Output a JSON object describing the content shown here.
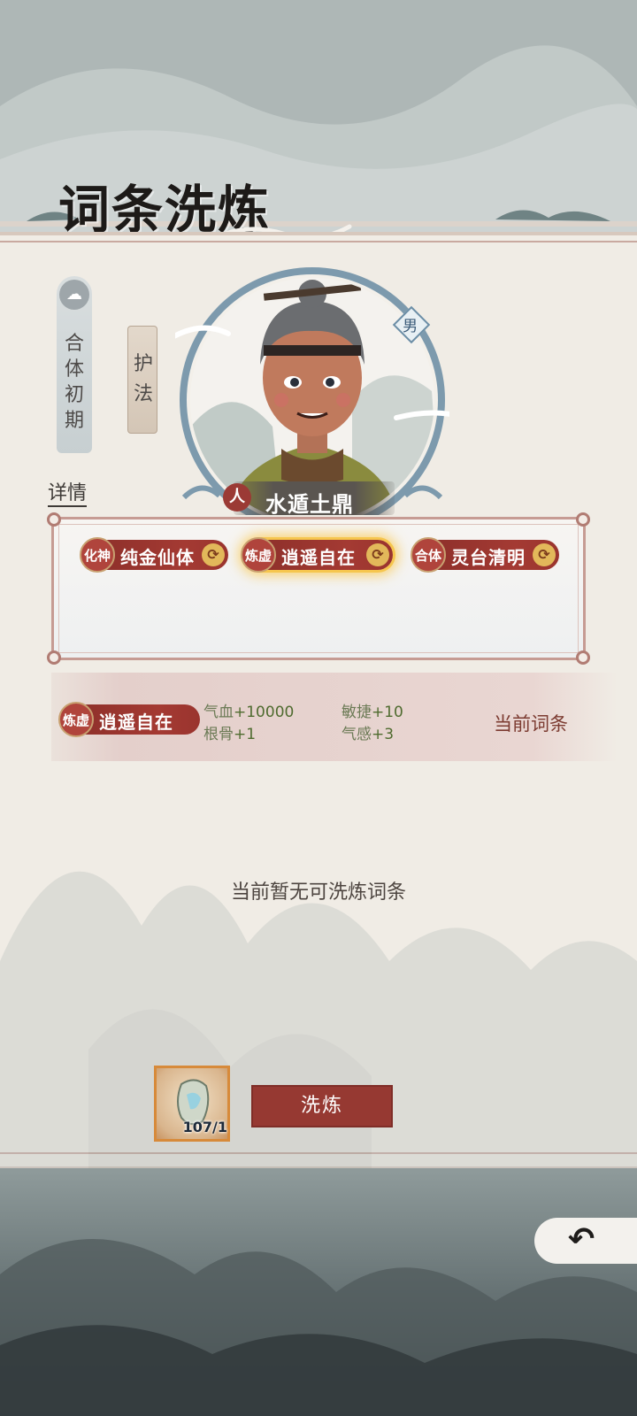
{
  "page": {
    "title": "词条洗炼"
  },
  "character": {
    "realm": "合体初期",
    "guard_tag": "护法",
    "gender": "男",
    "race": "人",
    "name": "水遁土鼎",
    "detail_link": "详情"
  },
  "affixes": [
    {
      "badge": "化神",
      "label": "纯金仙体",
      "selected": false
    },
    {
      "badge": "炼虚",
      "label": "逍遥自在",
      "selected": true
    },
    {
      "badge": "合体",
      "label": "灵台清明",
      "selected": false
    }
  ],
  "current_affix": {
    "badge": "炼虚",
    "label": "逍遥自在",
    "stats": {
      "s1_key": "气血",
      "s1_val": "+10000",
      "s2_key": "根骨",
      "s2_val": "+1",
      "s3_key": "敏捷",
      "s3_val": "+10",
      "s4_key": "气感",
      "s4_val": "+3"
    },
    "status": "当前词条"
  },
  "empty_message": "当前暂无可洗炼词条",
  "item": {
    "count": "107/1"
  },
  "refine_button": "洗炼",
  "icons": {
    "realm": "cloud-icon",
    "swap": "swap-icon",
    "back": "back-arrow-icon",
    "item": "refine-stone-icon"
  },
  "colors": {
    "accent": "#963932",
    "highlight": "#f6c64e",
    "stat_green": "#4f6b2f"
  }
}
